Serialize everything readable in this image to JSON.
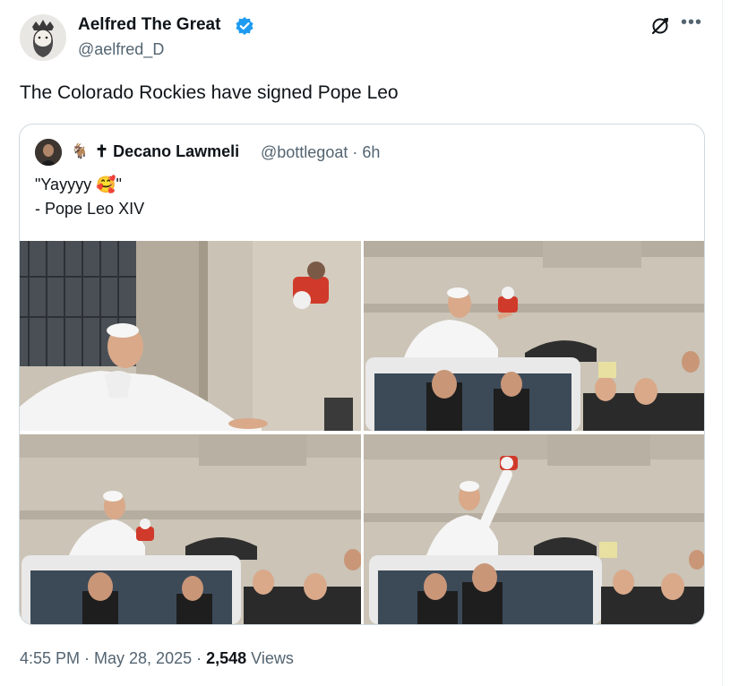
{
  "author": {
    "name": "Aelfred The Great",
    "handle": "@aelfred_D",
    "verified_color": "#1d9bf0"
  },
  "tweet": {
    "text": "The Colorado Rockies have signed Pope Leo"
  },
  "quote": {
    "goat_emoji": "🐐",
    "name": "✝ Decano Lawmeli",
    "handle_time": "@bottlegoat · 6h",
    "line1": "\"Yayyyy 🥰\"",
    "line2": "- Pope Leo XIV"
  },
  "meta": {
    "time_date": "4:55 PM · May 28, 2025 · ",
    "views_count": "2,548",
    "views_label": " Views"
  },
  "icons": {
    "more": "•••"
  }
}
